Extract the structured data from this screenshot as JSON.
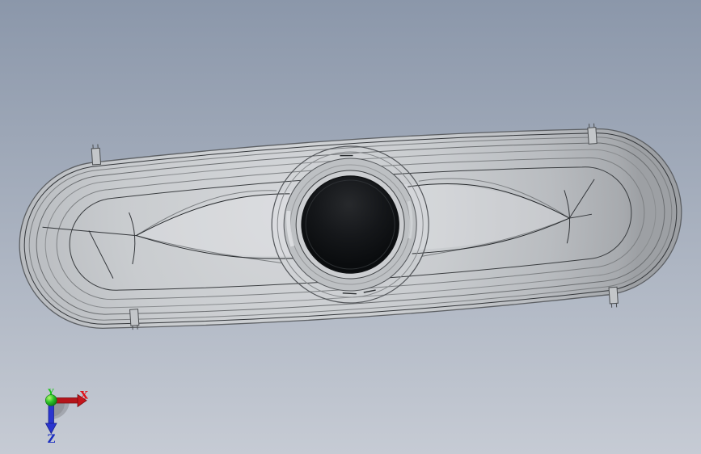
{
  "viewport": {
    "type": "3D CAD shaded-with-edges viewport",
    "background_top": "#8b97aa",
    "background_bottom": "#c6cbd4"
  },
  "part": {
    "name": "elongated oval cover with central circular hole",
    "body_color": "#c6c9cc",
    "edge_color": "#45484b",
    "hole_color": "#15171a"
  },
  "triad": {
    "axes": [
      {
        "label": "X",
        "color": "#e01118"
      },
      {
        "label": "Y",
        "color": "#15c415"
      },
      {
        "label": "Z",
        "color": "#1b2ec0"
      }
    ]
  }
}
